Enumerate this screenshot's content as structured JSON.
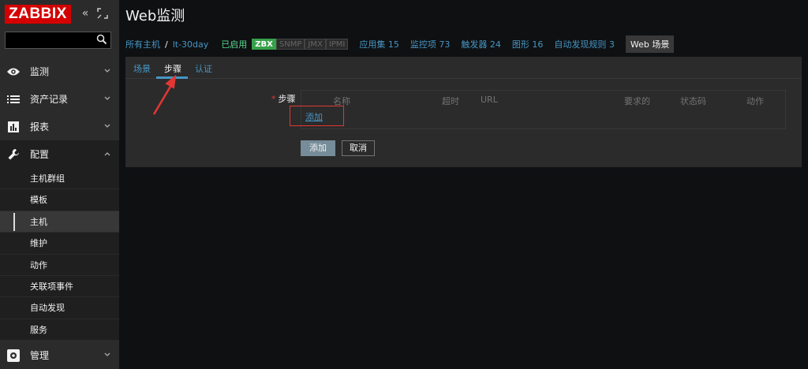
{
  "logo_text": "ZABBIX",
  "sidebar": {
    "search_placeholder": "",
    "menus": [
      {
        "label": "监测",
        "icon": "eye-icon"
      },
      {
        "label": "资产记录",
        "icon": "list-icon"
      },
      {
        "label": "报表",
        "icon": "bar-chart-icon"
      },
      {
        "label": "配置",
        "icon": "wrench-icon"
      },
      {
        "label": "管理",
        "icon": "gear-icon"
      }
    ],
    "config_items": [
      "主机群组",
      "模板",
      "主机",
      "维护",
      "动作",
      "关联项事件",
      "自动发现",
      "服务"
    ]
  },
  "page_title": "Web监测",
  "navbar": {
    "all_hosts": "所有主机",
    "separator": "/",
    "host": "lt-30day",
    "status": "已启用",
    "tags": [
      "ZBX",
      "SNMP",
      "JMX",
      "IPMI"
    ],
    "applications": "应用集 15",
    "items": "监控项 73",
    "triggers": "触发器 24",
    "graphs": "图形 16",
    "discovery": "自动发现规则 3",
    "web": "Web 场景"
  },
  "tabs": [
    "场景",
    "步骤",
    "认证"
  ],
  "form": {
    "required_mark": "*",
    "steps_label": "步骤",
    "columns": [
      "名称",
      "超时",
      "URL",
      "要求的",
      "状态码",
      "动作"
    ],
    "add_link": "添加",
    "submit": "添加",
    "cancel": "取消"
  },
  "colors": {
    "logo_red": "#d40000",
    "link_blue": "#4796c4",
    "enabled_green": "#59db8f",
    "zbx_green": "#36a04a",
    "annotation_red": "#e33734"
  }
}
